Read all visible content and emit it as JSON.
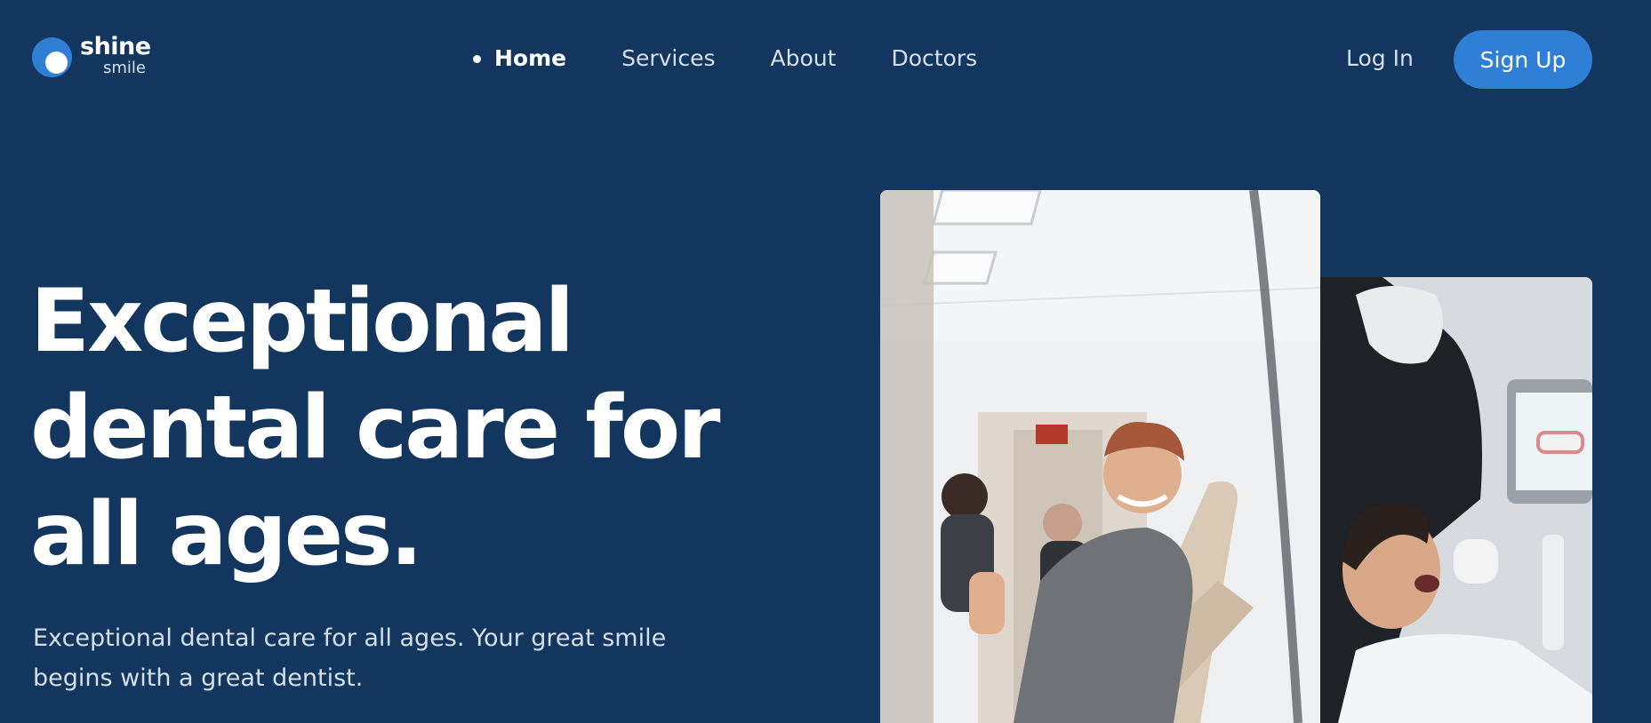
{
  "brand": {
    "name": "shine",
    "tagline": "smile",
    "accent_color": "#2f7fd6",
    "background_color": "#12365d"
  },
  "nav": {
    "items": [
      {
        "label": "Home",
        "active": true
      },
      {
        "label": "Services",
        "active": false
      },
      {
        "label": "About",
        "active": false
      },
      {
        "label": "Doctors",
        "active": false
      }
    ]
  },
  "auth": {
    "login_label": "Log In",
    "signup_label": "Sign Up"
  },
  "hero": {
    "title": "Exceptional dental care for all ages.",
    "subtitle": "Exceptional dental care for all ages. Your great smile begins with a great dentist."
  }
}
